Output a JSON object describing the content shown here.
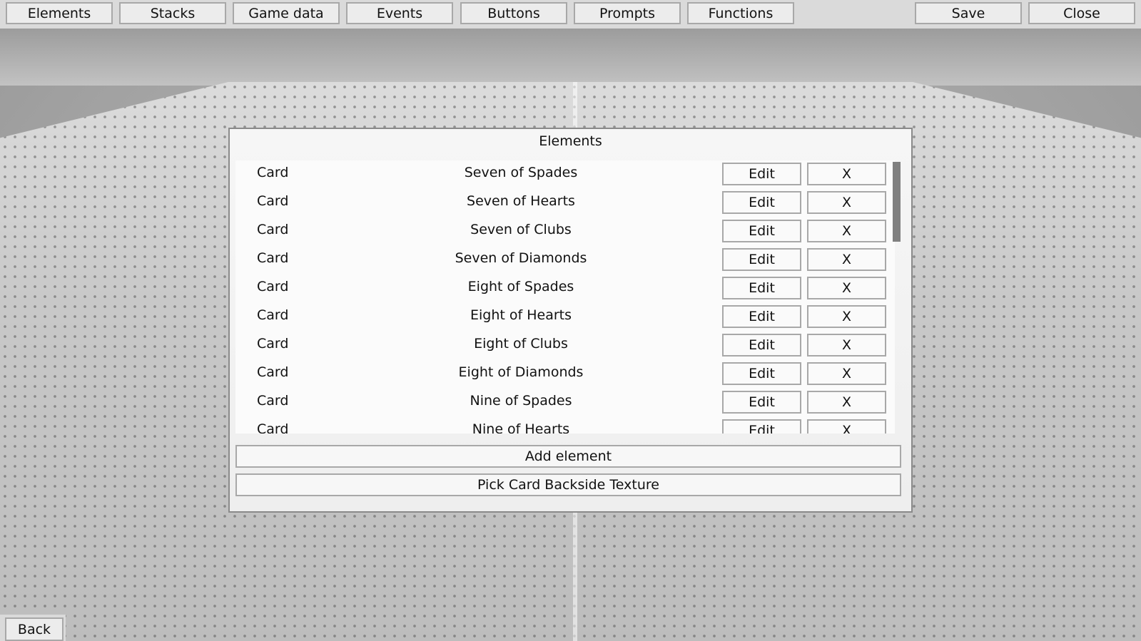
{
  "topbar": {
    "tabs": [
      {
        "label": "Elements"
      },
      {
        "label": "Stacks"
      },
      {
        "label": "Game data"
      },
      {
        "label": "Events"
      },
      {
        "label": "Buttons"
      },
      {
        "label": "Prompts"
      },
      {
        "label": "Functions"
      }
    ],
    "save_label": "Save",
    "close_label": "Close"
  },
  "dialog": {
    "title": "Elements",
    "rows": [
      {
        "type": "Card",
        "name": "Seven of Spades",
        "edit": "Edit",
        "remove": "X"
      },
      {
        "type": "Card",
        "name": "Seven of Hearts",
        "edit": "Edit",
        "remove": "X"
      },
      {
        "type": "Card",
        "name": "Seven of Clubs",
        "edit": "Edit",
        "remove": "X"
      },
      {
        "type": "Card",
        "name": "Seven of Diamonds",
        "edit": "Edit",
        "remove": "X"
      },
      {
        "type": "Card",
        "name": "Eight of Spades",
        "edit": "Edit",
        "remove": "X"
      },
      {
        "type": "Card",
        "name": "Eight of Hearts",
        "edit": "Edit",
        "remove": "X"
      },
      {
        "type": "Card",
        "name": "Eight of Clubs",
        "edit": "Edit",
        "remove": "X"
      },
      {
        "type": "Card",
        "name": "Eight of Diamonds",
        "edit": "Edit",
        "remove": "X"
      },
      {
        "type": "Card",
        "name": "Nine of Spades",
        "edit": "Edit",
        "remove": "X"
      },
      {
        "type": "Card",
        "name": "Nine of Hearts",
        "edit": "Edit",
        "remove": "X"
      }
    ],
    "add_label": "Add element",
    "backside_label": "Pick Card Backside Texture"
  },
  "footer": {
    "back_label": "Back"
  }
}
